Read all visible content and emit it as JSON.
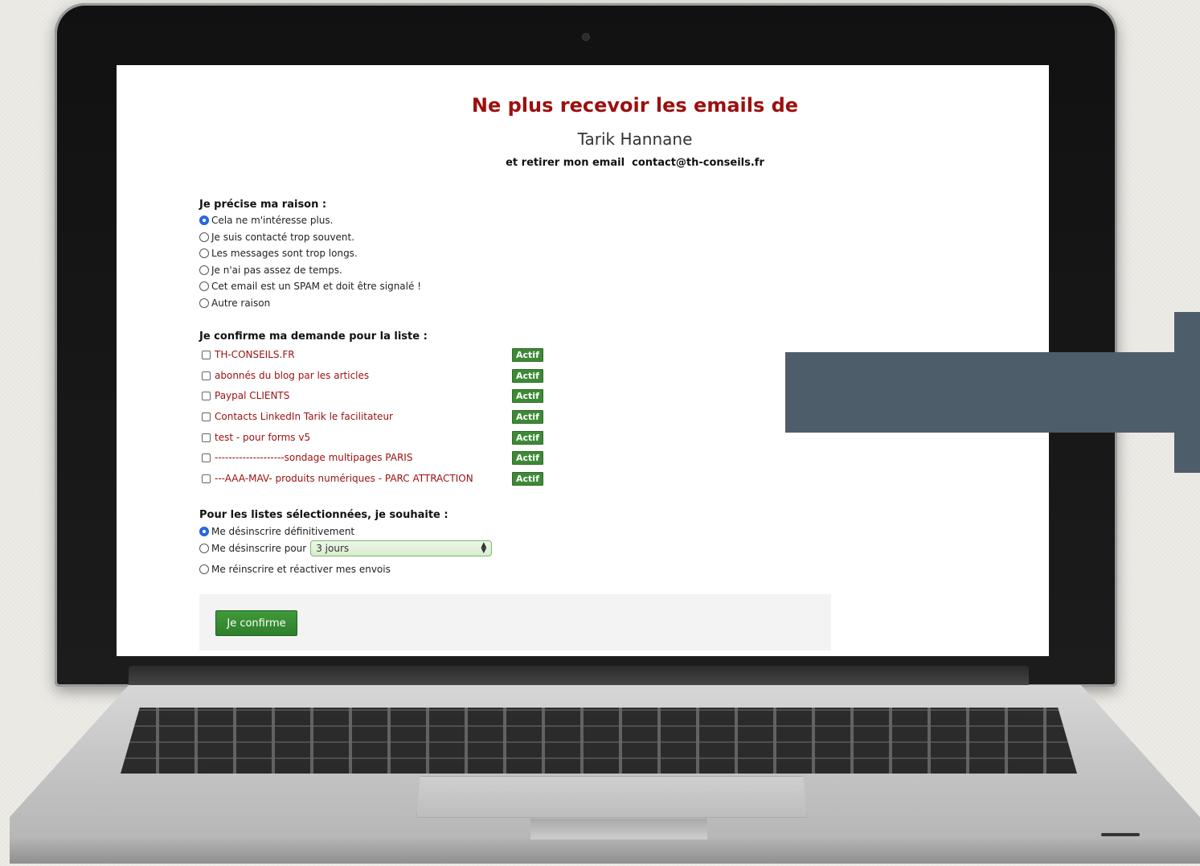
{
  "page": {
    "title": "Ne plus recevoir les emails de",
    "sender": "Tarik Hannane",
    "remove_prefix": "et retirer mon email",
    "email": "contact@th-conseils.fr"
  },
  "reason": {
    "heading": "Je précise ma raison :",
    "options": [
      {
        "label": "Cela ne m'intéresse plus.",
        "selected": true
      },
      {
        "label": "Je suis contacté trop souvent.",
        "selected": false
      },
      {
        "label": "Les messages sont trop longs.",
        "selected": false
      },
      {
        "label": "Je n'ai pas assez de temps.",
        "selected": false
      },
      {
        "label": "Cet email est un SPAM et doit être signalé !",
        "selected": false
      },
      {
        "label": "Autre raison",
        "selected": false
      }
    ]
  },
  "lists": {
    "heading": "Je confirme ma demande pour la liste :",
    "items": [
      {
        "label": "TH-CONSEILS.FR",
        "status": "Actif"
      },
      {
        "label": "abonnés du blog par les articles",
        "status": "Actif"
      },
      {
        "label": "Paypal CLIENTS",
        "status": "Actif"
      },
      {
        "label": "Contacts LinkedIn Tarik le facilitateur",
        "status": "Actif"
      },
      {
        "label": "test - pour forms v5",
        "status": "Actif"
      },
      {
        "label": "--------------------sondage multipages PARIS",
        "status": "Actif"
      },
      {
        "label": "---AAA-MAV- produits numériques - PARC ATTRACTION",
        "status": "Actif"
      }
    ]
  },
  "action": {
    "heading": "Pour les listes sélectionnées, je souhaite :",
    "opt_permanent": "Me désinscrire définitivement",
    "opt_for": "Me désinscrire pour",
    "duration_selected": "3 jours",
    "opt_resubscribe": "Me réinscrire et réactiver mes envois"
  },
  "confirm_button": "Je confirme",
  "colors": {
    "title_red": "#9c0f0f",
    "badge_green": "#3d8a36",
    "arrow_slate": "#4e5d6a"
  }
}
